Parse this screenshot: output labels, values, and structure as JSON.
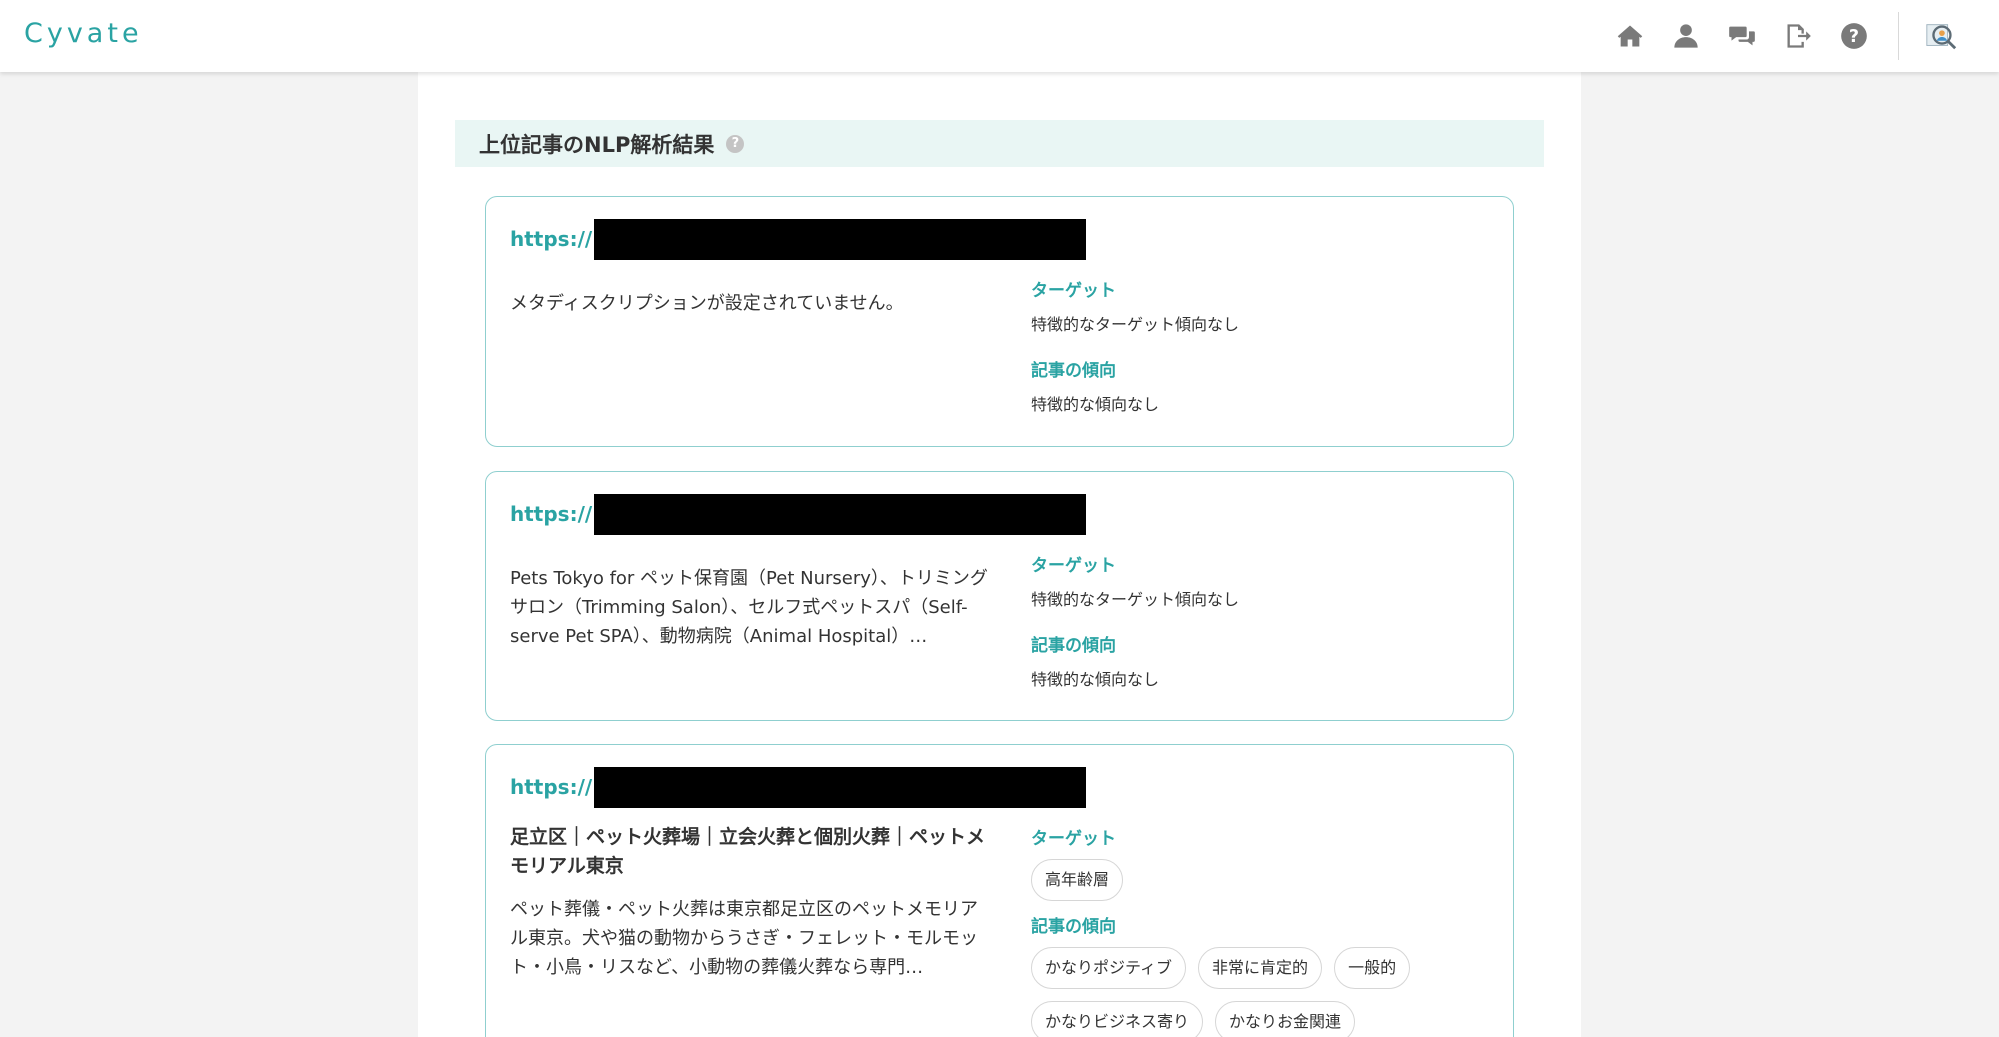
{
  "app": {
    "logo": "Cyvate"
  },
  "colors": {
    "accent": "#2aa3a3",
    "header_bg": "#e9f6f4",
    "card_border": "#8fcfcf"
  },
  "nav": {
    "icons": [
      "home-icon",
      "user-icon",
      "chat-icon",
      "logout-icon",
      "help-icon"
    ],
    "avatar": "avatar-icon"
  },
  "section": {
    "title": "上位記事のNLP解析結果",
    "help": "?"
  },
  "labels": {
    "target": "ターゲット",
    "tendency": "記事の傾向"
  },
  "cards": [
    {
      "url_prefix": "https://",
      "title": "",
      "description": "メタディスクリプションが設定されていません。",
      "target_text": "特徴的なターゲット傾向なし",
      "tendency_text": "特徴的な傾向なし"
    },
    {
      "url_prefix": "https://",
      "title": "",
      "description": "Pets Tokyo for ペット保育園（Pet Nursery）、トリミングサロン（Trimming Salon）、セルフ式ペットスパ（Self-serve Pet SPA）、動物病院（Animal Hospital）…",
      "target_text": "特徴的なターゲット傾向なし",
      "tendency_text": "特徴的な傾向なし"
    },
    {
      "url_prefix": "https://",
      "title": "足立区｜ペット火葬場｜立会火葬と個別火葬｜ペットメモリアル東京",
      "description": "ペット葬儀・ペット火葬は東京都足立区のペットメモリアル東京。犬や猫の動物からうさぎ・フェレット・モルモット・小鳥・リスなど、小動物の葬儀火葬なら専門…",
      "target_tags": [
        "高年齢層"
      ],
      "tendency_tags": [
        "かなりポジティブ",
        "非常に肯定的",
        "一般的",
        "かなりビジネス寄り",
        "かなりお金関連"
      ]
    }
  ]
}
